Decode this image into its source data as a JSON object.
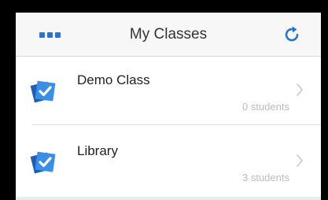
{
  "header": {
    "title": "My Classes",
    "menu_icon": "more-dots-icon",
    "refresh_icon": "refresh-icon"
  },
  "classes": [
    {
      "name": "Demo Class",
      "students": "0 students",
      "icon": "class-check-icon"
    },
    {
      "name": "Library",
      "students": "3 students",
      "icon": "class-check-icon"
    }
  ],
  "colors": {
    "accent": "#2b74c9",
    "navbar_bg": "#f7f7f7",
    "subtitle": "#bbbbbb"
  }
}
